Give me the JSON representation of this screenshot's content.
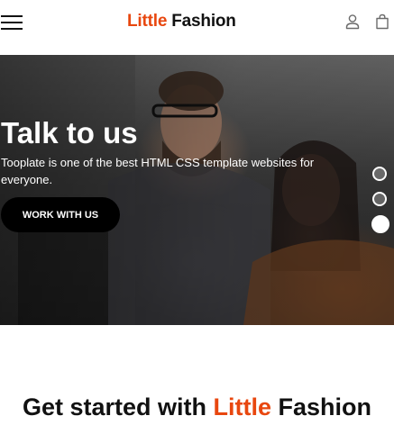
{
  "header": {
    "brand_first": "Little",
    "brand_second": "Fashion",
    "icons": [
      "menu-icon",
      "user-icon",
      "shopping-bag-icon"
    ]
  },
  "hero": {
    "title": "Talk to us",
    "text": "Tooplate is one of the best HTML CSS template websites for everyone.",
    "button_label": "WORK WITH US",
    "slides_count": 3,
    "active_slide": 3
  },
  "section": {
    "title_prefix": "Get started with",
    "title_accent": "Little",
    "title_suffix": "Fashion"
  },
  "colors": {
    "accent": "#e8470f",
    "text": "#111111",
    "button_bg": "#000000"
  }
}
